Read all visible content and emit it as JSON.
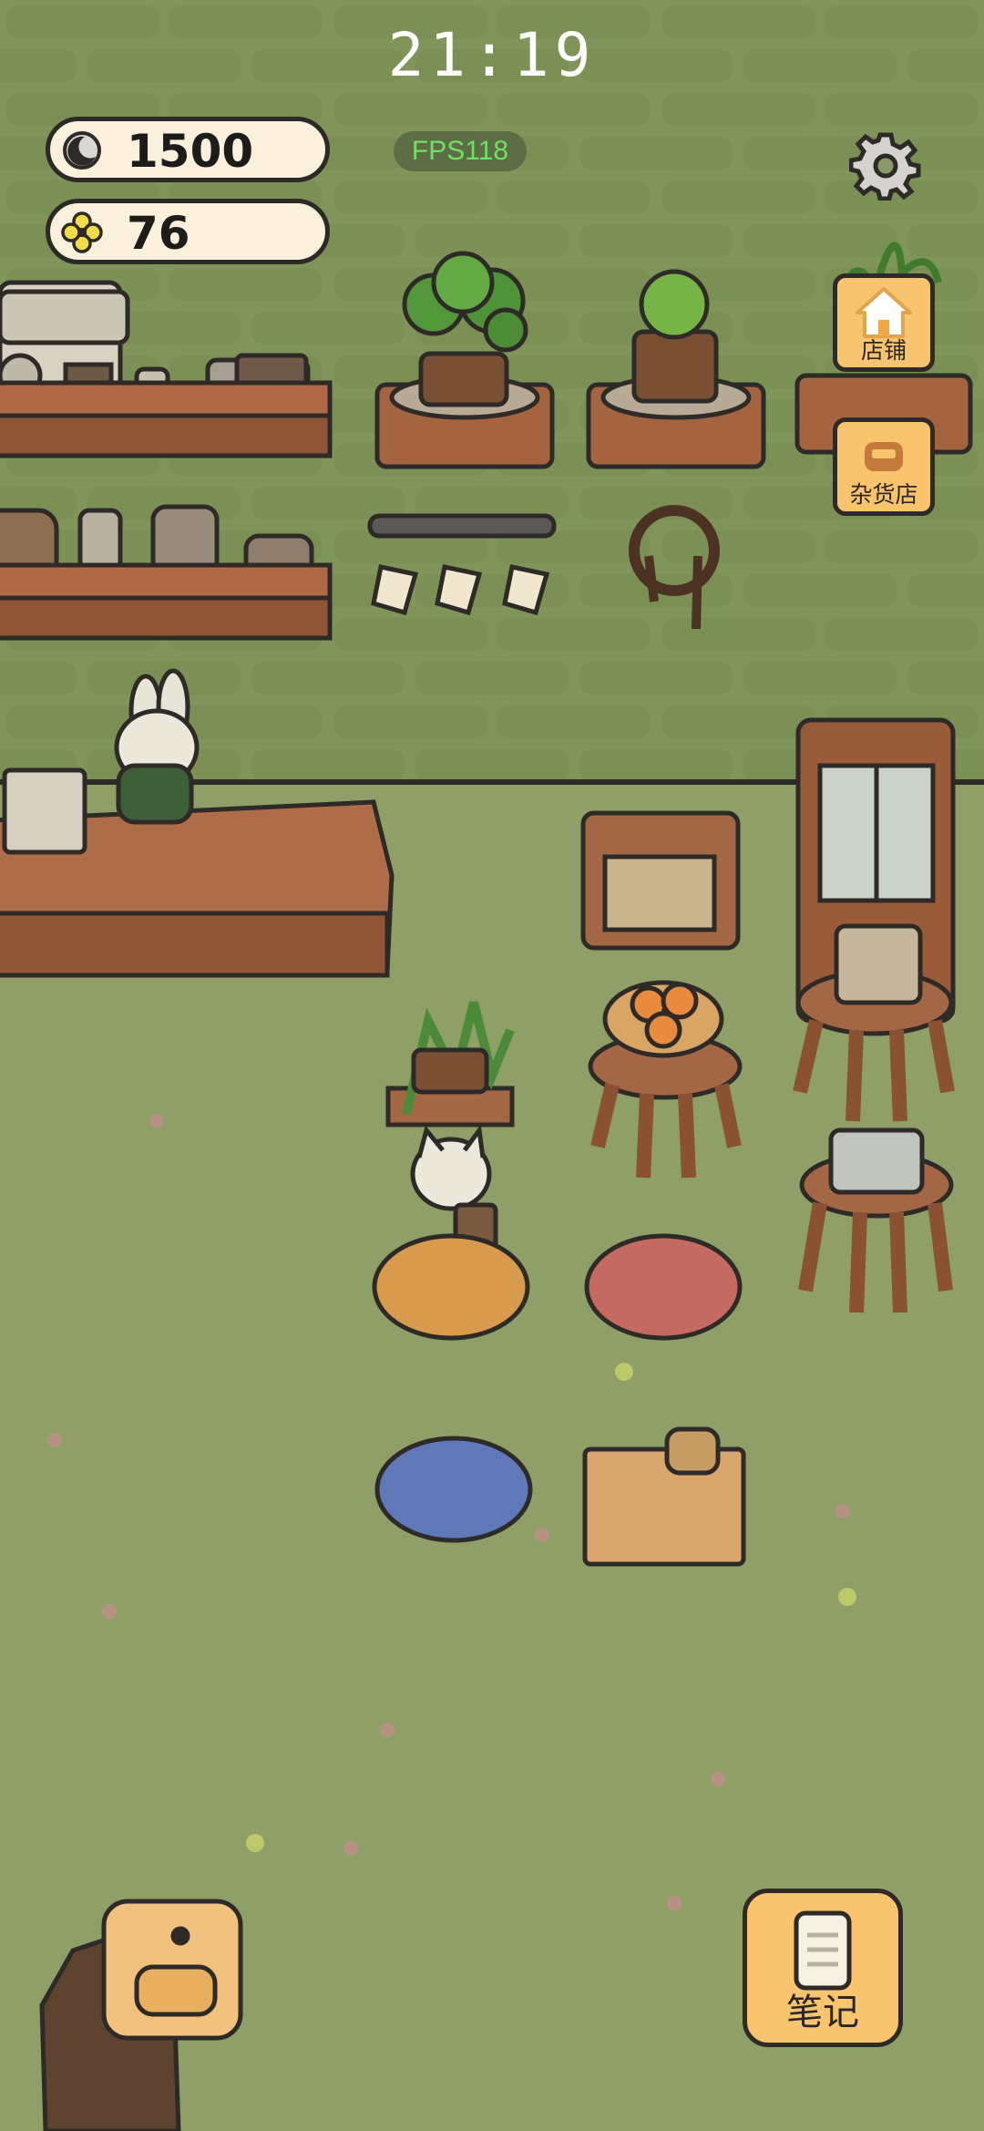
{
  "status": {
    "time": "21:19",
    "fps": "FPS118"
  },
  "currency": {
    "moon": {
      "icon": "moon-icon",
      "value": "1500"
    },
    "clover": {
      "icon": "clover-icon",
      "value": "76"
    }
  },
  "menu": {
    "shop_label": "店铺",
    "store_label": "杂货店",
    "notes_label": "笔记",
    "settings_icon": "gear-icon"
  },
  "colors": {
    "wall": "#7f9559",
    "floor": "#8ea067",
    "button": "#f8c46d",
    "pill": "#fbf0dc",
    "fps_text": "#6ee065"
  }
}
